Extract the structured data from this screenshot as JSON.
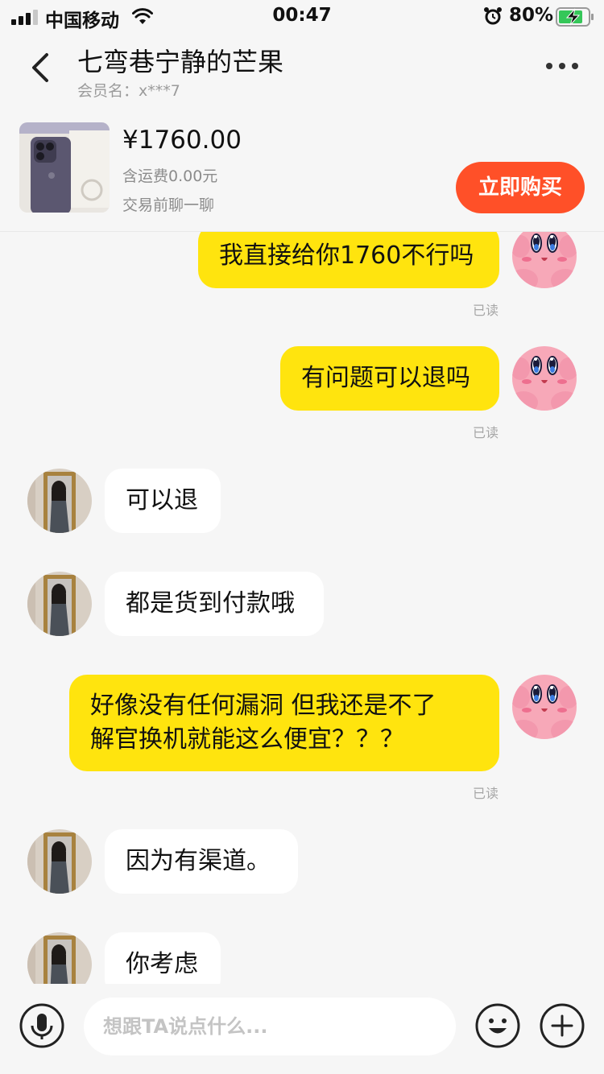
{
  "status_bar": {
    "carrier": "中国移动",
    "time": "00:47",
    "battery_percent": "80%",
    "icons": [
      "signal-icon",
      "wifi-icon",
      "alarm-icon",
      "battery-charging-icon"
    ]
  },
  "header": {
    "title": "七弯巷宁静的芒果",
    "member": "会员名：x***7"
  },
  "product": {
    "price": "¥1760.00",
    "shipping": "含运费0.00元",
    "chat_tip": "交易前聊一聊",
    "buy_label": "立即购买"
  },
  "messages": [
    {
      "from": "me",
      "text": "我直接给你1760不行吗",
      "status": "已读"
    },
    {
      "from": "me",
      "text": "有问题可以退吗",
      "status": "已读"
    },
    {
      "from": "them",
      "text": "可以退"
    },
    {
      "from": "them",
      "text": "都是货到付款哦"
    },
    {
      "from": "me",
      "text_line1": "好像没有任何漏洞 但我还是不了",
      "text_line2": "解官换机就能这么便宜？？？",
      "status": "已读"
    },
    {
      "from": "them",
      "text": "因为有渠道。"
    },
    {
      "from": "them",
      "text": "你考虑"
    }
  ],
  "input": {
    "placeholder": "想跟TA说点什么..."
  },
  "colors": {
    "my_bubble": "#ffe40e",
    "their_bubble": "#ffffff",
    "buy_button": "#ff5028",
    "background": "#f6f6f6"
  }
}
